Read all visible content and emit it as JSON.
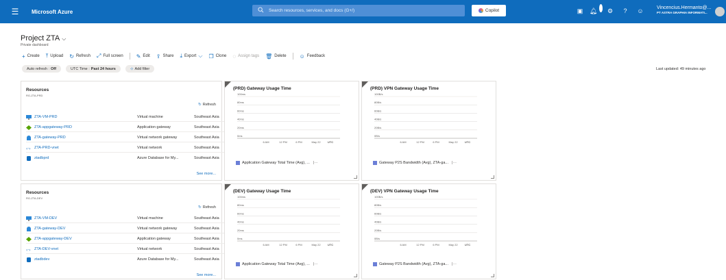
{
  "topbar": {
    "menu_icon": "hamburger-icon",
    "brand": "Microsoft Azure",
    "search_placeholder": "Search resources, services, and docs (G+/)",
    "copilot_label": "Copilot",
    "notification_count": "1",
    "user_name": "Vincencius.Hermanto@...",
    "user_org": "PT ASTRA GRAPHIA INFORMATI..."
  },
  "page": {
    "title": "Project ZTA",
    "subtitle": "Private dashboard"
  },
  "toolbar": {
    "create": "Create",
    "upload": "Upload",
    "refresh": "Refresh",
    "fullscreen": "Full screen",
    "edit": "Edit",
    "share": "Share",
    "export": "Export",
    "clone": "Clone",
    "assign_tags": "Assign tags",
    "delete": "Delete",
    "feedback": "Feedback"
  },
  "filters": {
    "auto_refresh_label": "Auto refresh :",
    "auto_refresh_value": "Off",
    "utc_label": "UTC Time :",
    "utc_value": "Past 24 hours",
    "add_filter": "Add filter"
  },
  "last_updated": "Last updated: 49 minutes ago",
  "resources_prd": {
    "title": "Resources",
    "subtitle": "RG-ZTA-PRD",
    "refresh": "Refresh",
    "see_more": "See more...",
    "rows": [
      {
        "name": "ZTA-VM-PRD",
        "type": "Virtual machine",
        "location": "Southeast Asia",
        "icon": "vm-icon"
      },
      {
        "name": "ZTA-appgateway-PRD",
        "type": "Application gateway",
        "location": "Southeast Asia",
        "icon": "app-gateway-icon"
      },
      {
        "name": "ZTA-gateway-PRD",
        "type": "Virtual network gateway",
        "location": "Southeast Asia",
        "icon": "vnet-gateway-icon"
      },
      {
        "name": "ZTA-PRD-vnet",
        "type": "Virtual network",
        "location": "Southeast Asia",
        "icon": "vnet-icon"
      },
      {
        "name": "ztadbprd",
        "type": "Azure Database for My...",
        "location": "Southeast Asia",
        "icon": "database-icon"
      }
    ]
  },
  "resources_dev": {
    "title": "Resources",
    "subtitle": "RG-ZTA-DEV",
    "refresh": "Refresh",
    "see_more": "See more...",
    "rows": [
      {
        "name": "ZTA-VM-DEV",
        "type": "Virtual machine",
        "location": "Southeast Asia",
        "icon": "vm-icon"
      },
      {
        "name": "ZTA-gateway-DEV",
        "type": "Virtual network gateway",
        "location": "Southeast Asia",
        "icon": "vnet-gateway-icon"
      },
      {
        "name": "ZTA-appgateway-DEV",
        "type": "Application gateway",
        "location": "Southeast Asia",
        "icon": "app-gateway-icon"
      },
      {
        "name": "ZTA-DEV-vnet",
        "type": "Virtual network",
        "location": "Southeast Asia",
        "icon": "vnet-icon"
      },
      {
        "name": "ztadbdev",
        "type": "Azure Database for My...",
        "location": "Southeast Asia",
        "icon": "database-icon"
      }
    ]
  },
  "chart_data": [
    {
      "type": "line",
      "title": "(PRD) Gateway Usage Time",
      "y_ticks": [
        "100ms",
        "80ms",
        "60ms",
        "40ms",
        "20ms",
        "0ms"
      ],
      "x_ticks": [
        "6 AM",
        "12 PM",
        "6 PM",
        "May 22",
        "UTC"
      ],
      "series": [
        {
          "name": "Application Gateway Total Time (Avg), ...",
          "values": []
        }
      ],
      "color": "#6b7fd7"
    },
    {
      "type": "line",
      "title": "(PRD) VPN Gateway Usage Time",
      "y_ticks": [
        "100B/s",
        "80B/s",
        "60B/s",
        "40B/s",
        "20B/s",
        "0B/s"
      ],
      "x_ticks": [
        "6 AM",
        "12 PM",
        "6 PM",
        "May 22",
        "UTC"
      ],
      "series": [
        {
          "name": "Gateway P2S Bandwidth (Avg), ZTA-ga...",
          "values": []
        }
      ],
      "color": "#6b7fd7"
    },
    {
      "type": "line",
      "title": "(DEV) Gateway Usage Time",
      "y_ticks": [
        "100ms",
        "80ms",
        "60ms",
        "40ms",
        "20ms",
        "0ms"
      ],
      "x_ticks": [
        "6 AM",
        "12 PM",
        "6 PM",
        "May 22",
        "UTC"
      ],
      "series": [
        {
          "name": "Application Gateway Total Time (Avg), ...",
          "values": []
        }
      ],
      "color": "#6b7fd7"
    },
    {
      "type": "line",
      "title": "(DEV) VPN Gateway Usage Time",
      "y_ticks": [
        "100B/s",
        "80B/s",
        "60B/s",
        "40B/s",
        "20B/s",
        "0B/s"
      ],
      "x_ticks": [
        "6 AM",
        "12 PM",
        "6 PM",
        "May 22",
        "UTC"
      ],
      "series": [
        {
          "name": "Gateway P2S Bandwidth (Avg), ZTA-ga...",
          "values": []
        }
      ],
      "color": "#6b7fd7"
    }
  ]
}
